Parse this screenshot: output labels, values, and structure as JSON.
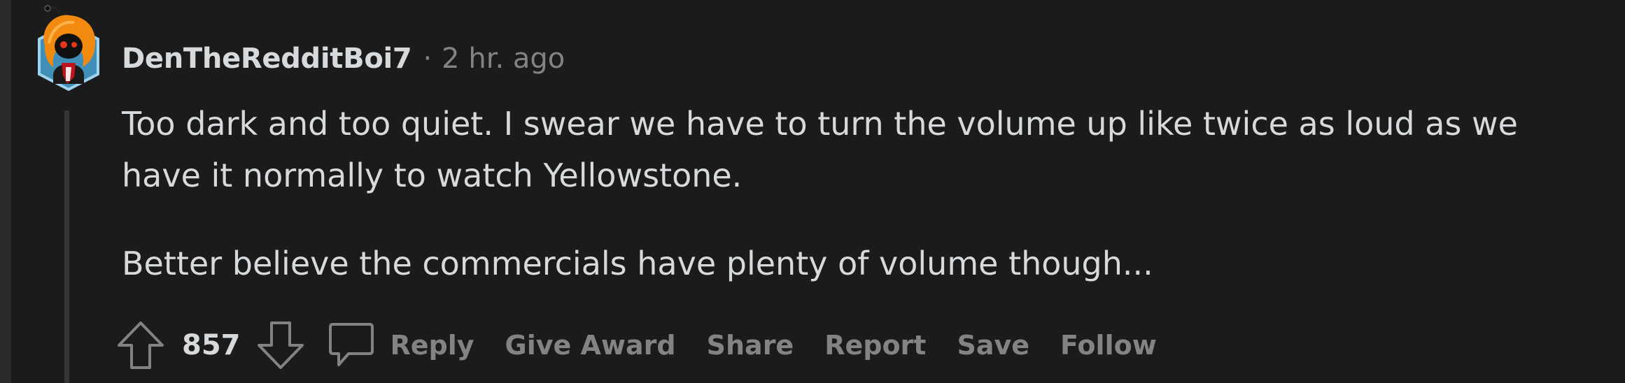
{
  "comment": {
    "username": "DenTheRedditBoi7",
    "separator": "·",
    "timestamp": "2 hr. ago",
    "paragraphs": [
      "Too dark and too quiet. I swear we have to turn the volume up like twice as loud as we have it normally to watch Yellowstone.",
      "Better believe the commercials have plenty of volume though..."
    ]
  },
  "actions": {
    "score": "857",
    "reply_label": "Reply",
    "give_award_label": "Give Award",
    "share_label": "Share",
    "report_label": "Report",
    "save_label": "Save",
    "follow_label": "Follow"
  },
  "icons": {
    "upvote": "upvote-arrow-icon",
    "downvote": "downvote-arrow-icon",
    "reply": "comment-bubble-icon",
    "avatar": "snoo-avatar"
  },
  "colors": {
    "background": "#1b1b1b",
    "text_primary": "#d7dadc",
    "text_muted": "#818384",
    "thread_line": "#343536"
  }
}
